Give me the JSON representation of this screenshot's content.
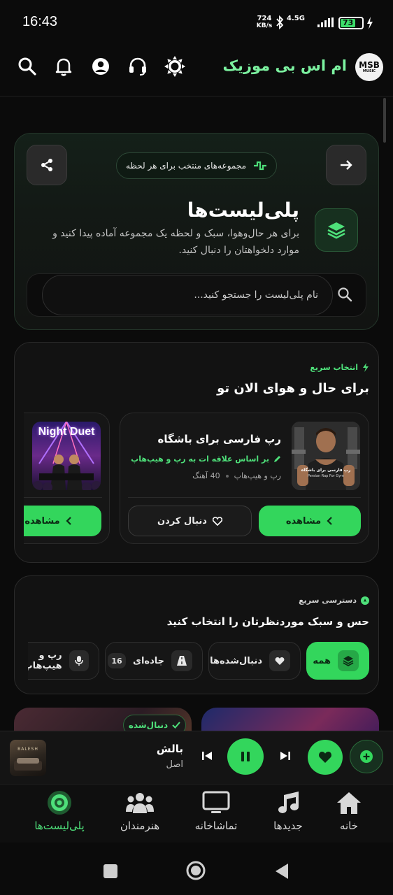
{
  "status_bar": {
    "time": "16:43",
    "net_speed_value": "724",
    "net_speed_unit": "KB/s",
    "network_type": "4.5G",
    "battery": "73",
    "battery_percent": 73
  },
  "header": {
    "brand": "ام اس بی موزیک",
    "logo_text": "MSB",
    "logo_sub": "MUSIC"
  },
  "hero": {
    "badge": "مجموعه‌های منتخب برای هر لحظه",
    "title": "پلی‌لیست‌ها",
    "description": "برای هر حال‌وهوا، سبک و لحظه یک مجموعه آماده پیدا کنید و موارد دلخواهتان را دنبال کنید.",
    "search_placeholder": "نام پلی‌لیست را جستجو کنید..."
  },
  "mood_section": {
    "tag": "انتخاب سریع",
    "title": "برای حال و هوای الان تو",
    "cards": [
      {
        "title": "رپ فارسی برای باشگاه",
        "reason": "بر اساس علاقه ات به رپ و هیپ‌هاپ",
        "genre": "رپ و هیپ‌هاپ",
        "count": "40 آهنگ",
        "cover_text": "رپ فارسی برای باشگاه",
        "cover_sub": "Persian Rap For Gym",
        "view_label": "مشاهده",
        "follow_label": "دنبال کردن"
      },
      {
        "cover_text": "Night Duet",
        "view_label": "مشاهده"
      }
    ]
  },
  "quick_access": {
    "tag": "دسترسی سریع",
    "title": "حس و سبک موردنظرتان را انتخاب کنید",
    "chips": [
      {
        "label": "همه",
        "icon": "layers-icon",
        "active": true
      },
      {
        "label": "دنبال‌شده‌ها",
        "icon": "heart-icon",
        "active": false
      },
      {
        "label": "جاده‌ای",
        "icon": "road-icon",
        "count": "16",
        "active": false
      },
      {
        "label": "رپ و هیپ‌هاپ",
        "icon": "mic-icon",
        "active": false
      }
    ]
  },
  "peek": {
    "followed_label": "دنبال‌شده"
  },
  "player": {
    "title": "بالش",
    "subtitle": "اصل",
    "thumb_text": "BALESH"
  },
  "nav": {
    "items": [
      {
        "label": "خانه",
        "icon": "home-icon"
      },
      {
        "label": "جدیدها",
        "icon": "music-note-icon"
      },
      {
        "label": "تماشاخانه",
        "icon": "tv-icon"
      },
      {
        "label": "هنرمندان",
        "icon": "users-icon"
      },
      {
        "label": "پلی‌لیست‌ها",
        "icon": "disc-icon",
        "active": true
      }
    ]
  },
  "colors": {
    "accent": "#33d65c",
    "accent_text": "#4ee07a",
    "brand": "#7cf2a0",
    "background": "#0b0b0b",
    "card": "#121212"
  }
}
